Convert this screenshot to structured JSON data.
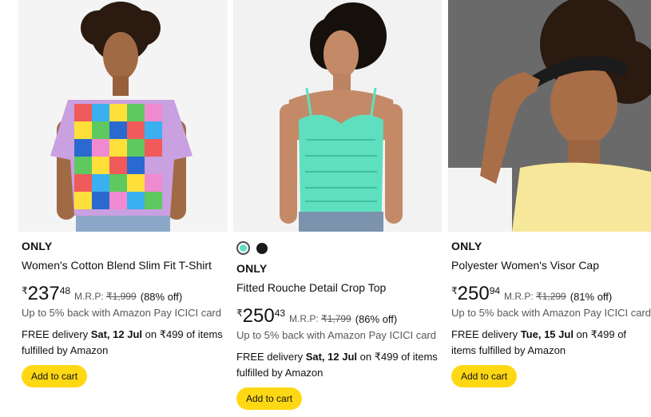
{
  "products": [
    {
      "brand": "ONLY",
      "title": "Women's Cotton Blend Slim Fit T-Shirt",
      "price": {
        "symbol": "₹",
        "whole": "237",
        "fraction": "48"
      },
      "mrp_label": "M.R.P:",
      "mrp_value": "₹1,999",
      "discount": "(88% off)",
      "cashback": "Up to 5% back with Amazon Pay ICICI card",
      "delivery_prefix": "FREE delivery ",
      "delivery_date": "Sat, 12 Jul",
      "delivery_suffix": " on ₹499 of items fulfilled by Amazon",
      "add_to_cart": "Add to cart"
    },
    {
      "brand": "ONLY",
      "title": "Fitted Rouche Detail Crop Top",
      "swatches": [
        "#5ee0c0",
        "#1a1a1a"
      ],
      "price": {
        "symbol": "₹",
        "whole": "250",
        "fraction": "43"
      },
      "mrp_label": "M.R.P:",
      "mrp_value": "₹1,799",
      "discount": "(86% off)",
      "cashback": "Up to 5% back with Amazon Pay ICICI card",
      "delivery_prefix": "FREE delivery ",
      "delivery_date": "Sat, 12 Jul",
      "delivery_suffix": " on ₹499 of items fulfilled by Amazon",
      "add_to_cart": "Add to cart"
    },
    {
      "brand": "ONLY",
      "title": "Polyester Women's Visor Cap",
      "price": {
        "symbol": "₹",
        "whole": "250",
        "fraction": "94"
      },
      "mrp_label": "M.R.P:",
      "mrp_value": "₹1,299",
      "discount": "(81% off)",
      "cashback": "Up to 5% back with Amazon Pay ICICI card",
      "delivery_prefix": "FREE delivery ",
      "delivery_date": "Tue, 15 Jul",
      "delivery_suffix": " on ₹499 of items fulfilled by Amazon",
      "add_to_cart": "Add to cart"
    }
  ],
  "colors": {
    "accent_button": "#ffd814",
    "muted_text": "#565959",
    "swatch_selected": "#5ee0c0",
    "swatch_other": "#1a1a1a"
  }
}
